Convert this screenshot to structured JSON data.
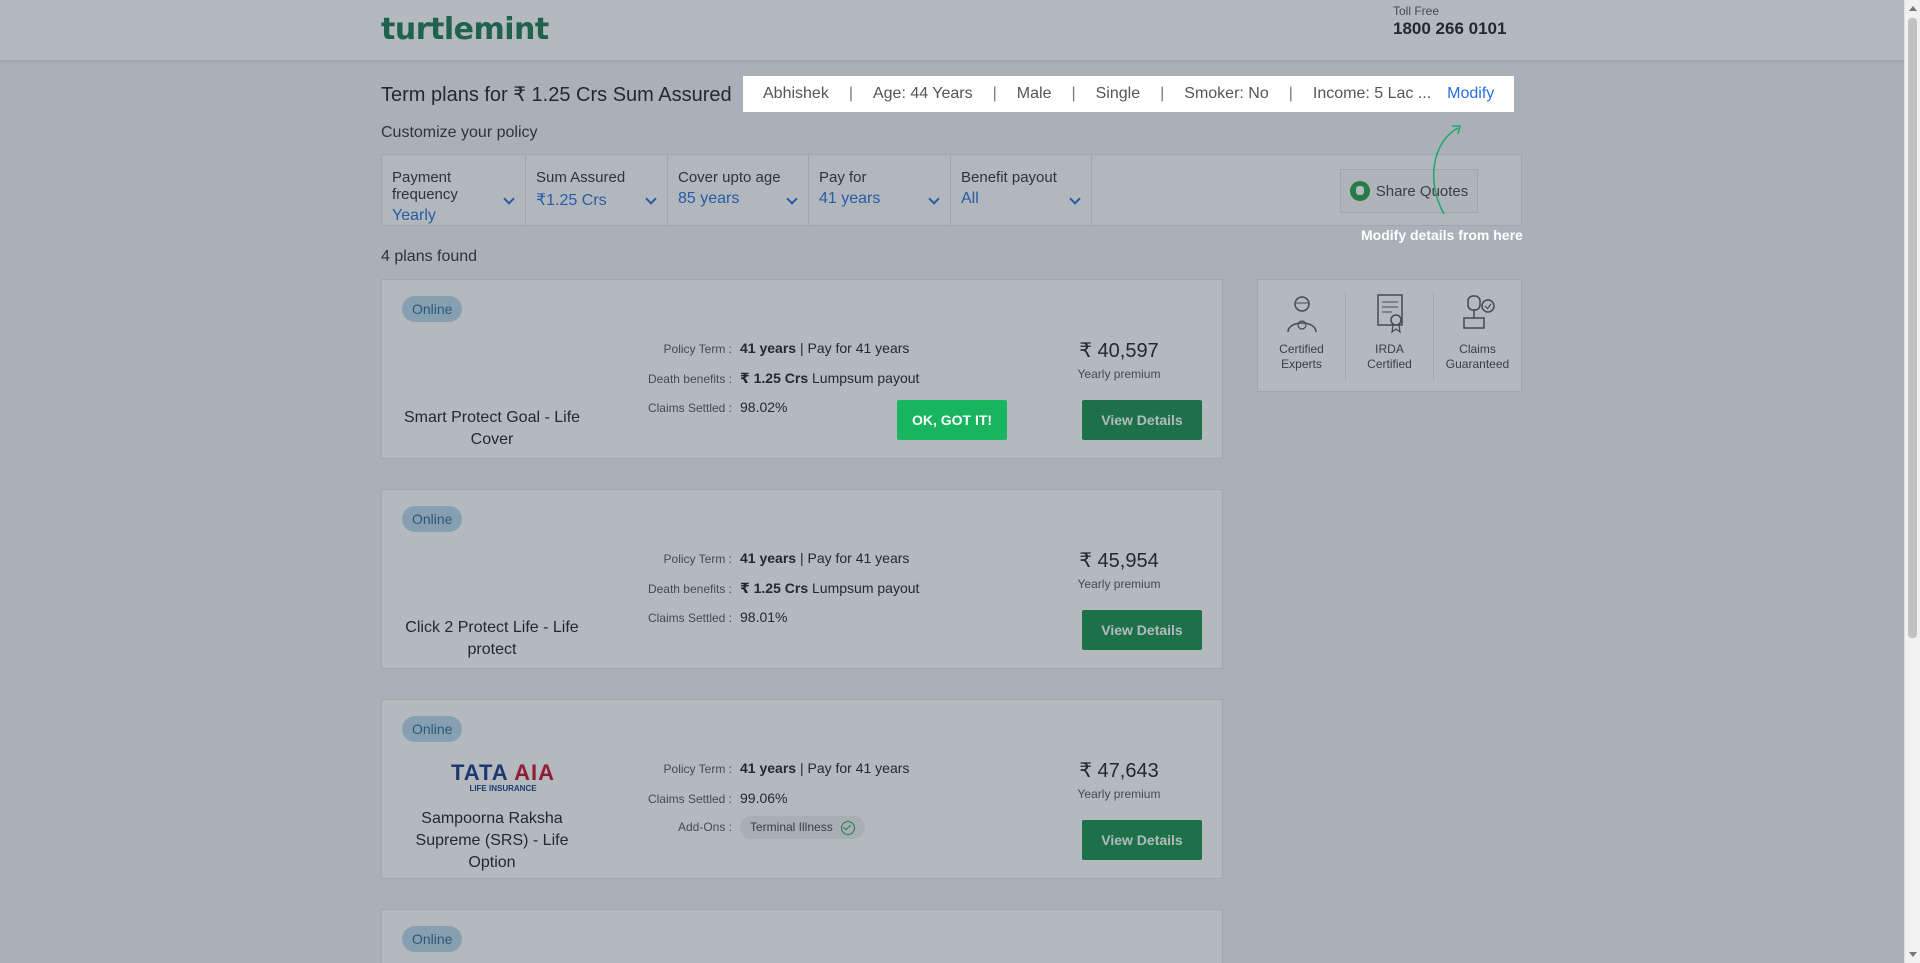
{
  "header": {
    "logo": "turtlemint",
    "toll_label": "Toll Free",
    "toll_number": "1800 266 0101"
  },
  "title": "Term plans for ₹ 1.25 Crs Sum Assured",
  "summary": {
    "name": "Abhishek",
    "age": "Age: 44 Years",
    "gender": "Male",
    "marital": "Single",
    "smoker": "Smoker: No",
    "income": "Income: 5 Lac ...",
    "modify": "Modify"
  },
  "customize_label": "Customize your policy",
  "filters": [
    {
      "label": "Payment frequency",
      "value": "Yearly"
    },
    {
      "label": "Sum Assured",
      "value": "₹1.25 Crs"
    },
    {
      "label": "Cover upto age",
      "value": "85 years"
    },
    {
      "label": "Pay for",
      "value": "41 years"
    },
    {
      "label": "Benefit payout",
      "value": "All"
    }
  ],
  "share_quotes": "Share Quotes",
  "hint": "Modify details from here",
  "ok_button": "OK, GOT IT!",
  "plans_found": "4 plans found",
  "plans": [
    {
      "badge": "Online",
      "name": "Smart Protect Goal - Life Cover",
      "policy_term_label": "Policy Term :",
      "policy_term_bold": "41 years",
      "policy_term_rest": " | Pay for 41 years",
      "death_label": "Death benefits :",
      "death_bold": "₹ 1.25 Crs",
      "death_rest": " Lumpsum payout",
      "claims_label": "Claims Settled :",
      "claims_value": "98.02%",
      "premium": "₹ 40,597",
      "premium_label": "Yearly premium",
      "button": "View Details"
    },
    {
      "badge": "Online",
      "name": "Click 2 Protect Life - Life protect",
      "policy_term_label": "Policy Term :",
      "policy_term_bold": "41 years",
      "policy_term_rest": " | Pay for 41 years",
      "death_label": "Death benefits :",
      "death_bold": "₹ 1.25 Crs",
      "death_rest": " Lumpsum payout",
      "claims_label": "Claims Settled :",
      "claims_value": "98.01%",
      "premium": "₹ 45,954",
      "premium_label": "Yearly premium",
      "button": "View Details"
    },
    {
      "badge": "Online",
      "insurer_logo_main": "TATA",
      "insurer_logo_accent": "AIA",
      "insurer_logo_sub": "LIFE INSURANCE",
      "name": "Sampoorna Raksha Supreme (SRS) - Life Option",
      "policy_term_label": "Policy Term :",
      "policy_term_bold": "41 years",
      "policy_term_rest": " | Pay for 41 years",
      "claims_label": "Claims Settled :",
      "claims_value": "99.06%",
      "addons_label": "Add-Ons :",
      "addon": "Terminal Illness",
      "premium": "₹ 47,643",
      "premium_label": "Yearly premium",
      "button": "View Details"
    },
    {
      "badge": "Online"
    }
  ],
  "trust": [
    {
      "line1": "Certified",
      "line2": "Experts",
      "icon": "expert-icon"
    },
    {
      "line1": "IRDA",
      "line2": "Certified",
      "icon": "certificate-icon"
    },
    {
      "line1": "Claims",
      "line2": "Guaranteed",
      "icon": "claims-icon"
    }
  ]
}
